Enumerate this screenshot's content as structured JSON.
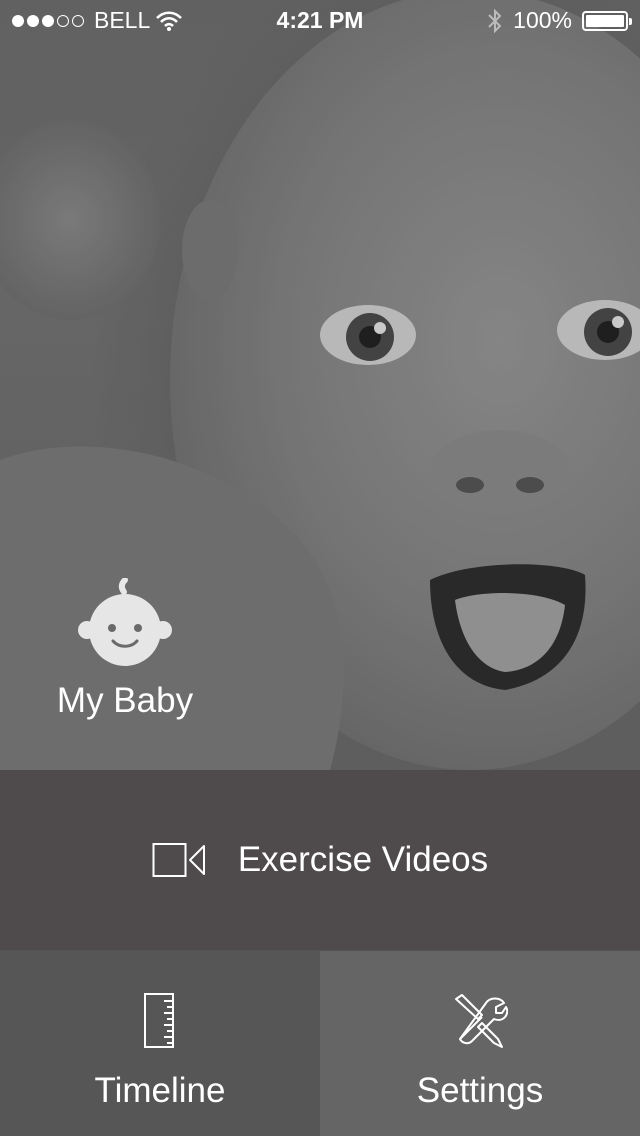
{
  "status_bar": {
    "carrier": "BELL",
    "time": "4:21 PM",
    "battery": "100%",
    "signal_bars_filled": 3,
    "signal_bars_total": 5
  },
  "hero": {
    "my_baby_label": "My Baby"
  },
  "menu": {
    "exercise_label": "Exercise Videos",
    "timeline_label": "Timeline",
    "settings_label": "Settings"
  },
  "icons": {
    "baby": "baby-face-icon",
    "exercise": "video-camera-icon",
    "timeline": "ruler-icon",
    "settings": "tools-icon"
  },
  "colors": {
    "exercise_bg": "#4f4b4c",
    "timeline_bg": "#565656",
    "settings_bg": "#656565"
  }
}
